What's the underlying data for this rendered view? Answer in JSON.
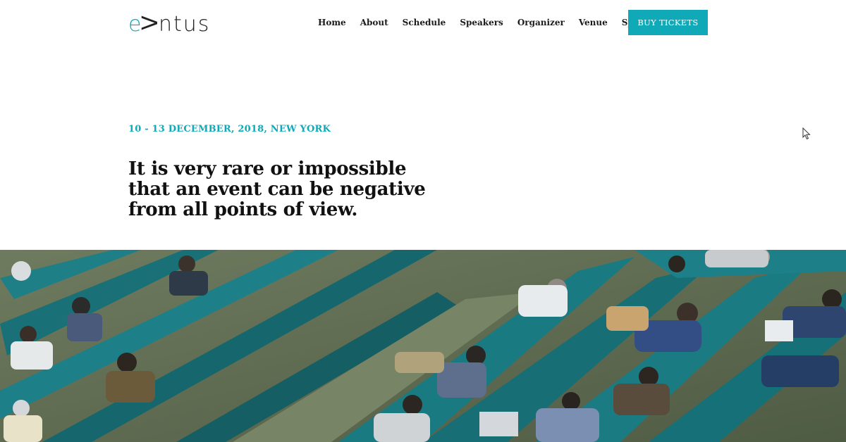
{
  "header": {
    "logo_prefix": "e",
    "logo_v": "V",
    "logo_rest": "ntus",
    "nav": [
      {
        "label": "Home"
      },
      {
        "label": "About"
      },
      {
        "label": "Schedule"
      },
      {
        "label": "Speakers"
      },
      {
        "label": "Organizer"
      },
      {
        "label": "Venue"
      },
      {
        "label": "Sponsors"
      }
    ],
    "cta_label": "BUY TICKETS"
  },
  "hero": {
    "event_date": "10 - 13 DECEMBER, 2018, NEW YORK",
    "headline": "It is very rare or impossible that an event can be negative from all points of view."
  },
  "colors": {
    "accent": "#10a9b8",
    "text": "#111111",
    "background": "#ffffff"
  },
  "icons": {
    "cursor": "mouse-pointer-icon"
  }
}
